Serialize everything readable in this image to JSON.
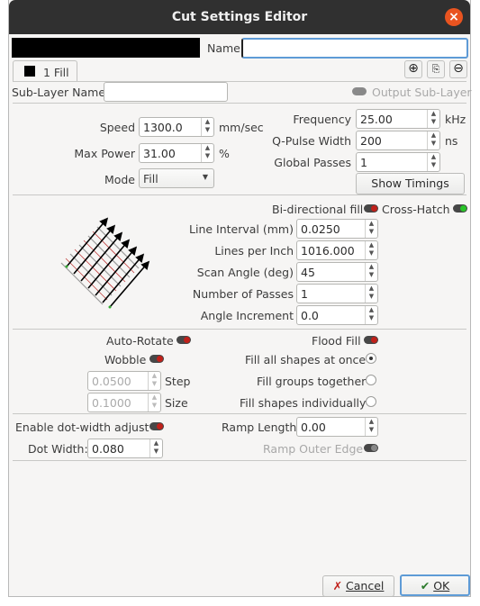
{
  "window": {
    "title": "Cut Settings Editor"
  },
  "top": {
    "name_label": "Name",
    "name_value": "",
    "layer_color": "#000000"
  },
  "tab": {
    "label": "1 Fill"
  },
  "toolbar": {
    "add_icon": "add-icon",
    "copy_icon": "copy-icon",
    "remove_icon": "remove-icon"
  },
  "sublayer": {
    "label": "Sub-Layer Name",
    "value": "",
    "output_label": "Output Sub-Layer"
  },
  "params": {
    "speed_label": "Speed",
    "speed_value": "1300.0",
    "speed_unit": "mm/sec",
    "maxpower_label": "Max Power",
    "maxpower_value": "31.00",
    "maxpower_unit": "%",
    "mode_label": "Mode",
    "mode_value": "Fill",
    "frequency_label": "Frequency",
    "frequency_value": "25.00",
    "frequency_unit": "kHz",
    "qpulse_label": "Q-Pulse Width",
    "qpulse_value": "200",
    "qpulse_unit": "ns",
    "passes_label": "Global Passes",
    "passes_value": "1",
    "show_timings": "Show Timings"
  },
  "fill": {
    "bidir_label": "Bi-directional fill",
    "crosshatch_label": "Cross-Hatch",
    "interval_label": "Line Interval (mm)",
    "interval_value": "0.0250",
    "lpi_label": "Lines per Inch",
    "lpi_value": "1016.000",
    "angle_label": "Scan Angle (deg)",
    "angle_value": "45",
    "numpasses_label": "Number of Passes",
    "numpasses_value": "1",
    "anginc_label": "Angle Increment",
    "anginc_value": "0.0"
  },
  "options": {
    "autorotate_label": "Auto-Rotate",
    "floodfill_label": "Flood Fill",
    "wobble_label": "Wobble",
    "step_value": "0.0500",
    "step_label": "Step",
    "size_value": "0.1000",
    "size_label": "Size",
    "fillall_label": "Fill all shapes at once",
    "fillgroups_label": "Fill groups together",
    "fillindiv_label": "Fill shapes individually"
  },
  "dot": {
    "enable_label": "Enable dot-width adjust",
    "dotwidth_label": "Dot Width:",
    "dotwidth_value": "0.080",
    "ramp_label": "Ramp Length",
    "ramp_value": "0.00",
    "rampedge_label": "Ramp Outer Edge"
  },
  "footer": {
    "cancel_label": "Cancel",
    "ok_label": "OK"
  }
}
